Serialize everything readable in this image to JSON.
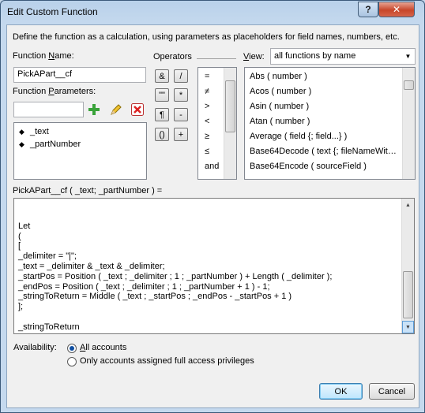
{
  "window": {
    "title": "Edit Custom Function"
  },
  "titlebar_buttons": {
    "help": "?",
    "close": "✕"
  },
  "description": "Define the function as a calculation, using parameters as placeholders for field names, numbers, etc.",
  "function_name": {
    "label_pre": "Function ",
    "label_u": "N",
    "label_post": "ame:",
    "value": "PickAPart__cf"
  },
  "function_parameters": {
    "label_pre": "Function ",
    "label_u": "P",
    "label_post": "arameters:",
    "input_value": "",
    "items": [
      {
        "label": "_text"
      },
      {
        "label": "_partNumber"
      }
    ]
  },
  "operators": {
    "label": "Operators",
    "buttons": [
      {
        "label": "&"
      },
      {
        "label": "/"
      },
      {
        "label": "\"\""
      },
      {
        "label": "*"
      },
      {
        "label": "¶"
      },
      {
        "label": "-"
      },
      {
        "label": "()"
      },
      {
        "label": "+"
      }
    ],
    "list": [
      "=",
      "≠",
      ">",
      "<",
      "≥",
      "≤",
      "and"
    ]
  },
  "view": {
    "label_pre": "",
    "label_u": "V",
    "label_post": "iew:",
    "selected": "all functions by name",
    "functions": [
      "Abs ( number )",
      "Acos ( number )",
      "Asin ( number )",
      "Atan ( number )",
      "Average ( field {; field...} )",
      "Base64Decode ( text {; fileNameWit…",
      "Base64Encode ( sourceField )"
    ]
  },
  "signature": "PickAPart__cf ( _text; _partNumber ) =",
  "calculation_lines": [
    "",
    "Let",
    "(",
    "[",
    "_delimiter = \"|\";",
    "_text = _delimiter & _text & _delimiter;",
    "_startPos = Position ( _text ; _delimiter ; 1 ; _partNumber ) + Length ( _delimiter );",
    "_endPos = Position ( _text ; _delimiter ; 1 ; _partNumber + 1 ) - 1;",
    "_stringToReturn = Middle ( _text ; _startPos ; _endPos - _startPos + 1 )",
    "];",
    "",
    "_stringToReturn",
    ")"
  ],
  "availability": {
    "label": "Availability:",
    "options": [
      {
        "label_u": "A",
        "label_post": "ll accounts",
        "selected": true
      },
      {
        "label_pre": "Only accounts assigned full access privileges",
        "selected": false
      }
    ]
  },
  "buttons": {
    "ok": "OK",
    "cancel": "Cancel"
  }
}
